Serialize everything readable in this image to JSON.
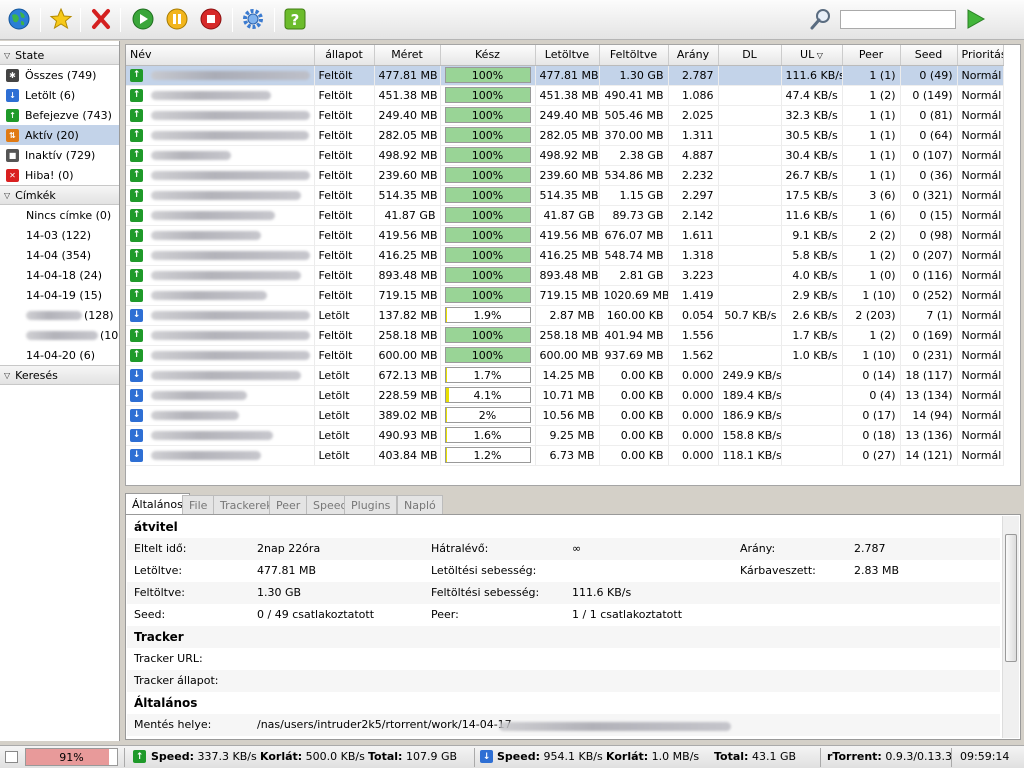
{
  "search": {
    "placeholder": ""
  },
  "sidebar": {
    "state_header": "State",
    "states": [
      {
        "label": "Összes (749)",
        "icon": "all-icon",
        "color": "#444"
      },
      {
        "label": "Letölt (6)",
        "icon": "download-icon",
        "color": "#2e6fd4"
      },
      {
        "label": "Befejezve (743)",
        "icon": "finished-icon",
        "color": "#1f9a2a"
      },
      {
        "label": "Aktív (20)",
        "icon": "active-icon",
        "color": "#e07a14"
      },
      {
        "label": "Inaktív (729)",
        "icon": "inactive-icon",
        "color": "#555"
      },
      {
        "label": "Hiba! (0)",
        "icon": "error-icon",
        "color": "#d92020"
      }
    ],
    "labels_header": "Címkék",
    "labels": [
      {
        "label": "Nincs címke (0)",
        "blur": false
      },
      {
        "label": "14-03 (122)",
        "blur": false
      },
      {
        "label": "14-04 (354)",
        "blur": false
      },
      {
        "label": "14-04-18 (24)",
        "blur": false
      },
      {
        "label": "14-04-19 (15)",
        "blur": false
      },
      {
        "label": "(128)",
        "blur": true
      },
      {
        "label": "(10",
        "blur": true
      },
      {
        "label": "14-04-20 (6)",
        "blur": false
      }
    ],
    "search_header": "Keresés"
  },
  "list": {
    "columns": [
      "Név",
      "állapot",
      "Méret",
      "Kész",
      "Letöltve",
      "Feltöltve",
      "Arány",
      "DL",
      "UL",
      "Peer",
      "Seed",
      "Prioritás"
    ],
    "rows": [
      {
        "status": "Feltölt",
        "dir": "up",
        "size": "477.81 MB",
        "done": "100%",
        "pct": 100,
        "dl": "477.81 MB",
        "ul": "1.30 GB",
        "ratio": "2.787",
        "dlspeed": "",
        "ulspeed": "111.6 KB/s",
        "peer": "1 (1)",
        "seed": "0 (49)",
        "prio": "Normál"
      },
      {
        "status": "Feltölt",
        "dir": "up",
        "size": "451.38 MB",
        "done": "100%",
        "pct": 100,
        "dl": "451.38 MB",
        "ul": "490.41 MB",
        "ratio": "1.086",
        "dlspeed": "",
        "ulspeed": "47.4 KB/s",
        "peer": "1 (2)",
        "seed": "0 (149)",
        "prio": "Normál"
      },
      {
        "status": "Feltölt",
        "dir": "up",
        "size": "249.40 MB",
        "done": "100%",
        "pct": 100,
        "dl": "249.40 MB",
        "ul": "505.46 MB",
        "ratio": "2.025",
        "dlspeed": "",
        "ulspeed": "32.3 KB/s",
        "peer": "1 (1)",
        "seed": "0 (81)",
        "prio": "Normál"
      },
      {
        "status": "Feltölt",
        "dir": "up",
        "size": "282.05 MB",
        "done": "100%",
        "pct": 100,
        "dl": "282.05 MB",
        "ul": "370.00 MB",
        "ratio": "1.311",
        "dlspeed": "",
        "ulspeed": "30.5 KB/s",
        "peer": "1 (1)",
        "seed": "0 (64)",
        "prio": "Normál"
      },
      {
        "status": "Feltölt",
        "dir": "up",
        "size": "498.92 MB",
        "done": "100%",
        "pct": 100,
        "dl": "498.92 MB",
        "ul": "2.38 GB",
        "ratio": "4.887",
        "dlspeed": "",
        "ulspeed": "30.4 KB/s",
        "peer": "1 (1)",
        "seed": "0 (107)",
        "prio": "Normál"
      },
      {
        "status": "Feltölt",
        "dir": "up",
        "size": "239.60 MB",
        "done": "100%",
        "pct": 100,
        "dl": "239.60 MB",
        "ul": "534.86 MB",
        "ratio": "2.232",
        "dlspeed": "",
        "ulspeed": "26.7 KB/s",
        "peer": "1 (1)",
        "seed": "0 (36)",
        "prio": "Normál"
      },
      {
        "status": "Feltölt",
        "dir": "up",
        "size": "514.35 MB",
        "done": "100%",
        "pct": 100,
        "dl": "514.35 MB",
        "ul": "1.15 GB",
        "ratio": "2.297",
        "dlspeed": "",
        "ulspeed": "17.5 KB/s",
        "peer": "3 (6)",
        "seed": "0 (321)",
        "prio": "Normál"
      },
      {
        "status": "Feltölt",
        "dir": "up",
        "size": "41.87 GB",
        "done": "100%",
        "pct": 100,
        "dl": "41.87 GB",
        "ul": "89.73 GB",
        "ratio": "2.142",
        "dlspeed": "",
        "ulspeed": "11.6 KB/s",
        "peer": "1 (6)",
        "seed": "0 (15)",
        "prio": "Normál"
      },
      {
        "status": "Feltölt",
        "dir": "up",
        "size": "419.56 MB",
        "done": "100%",
        "pct": 100,
        "dl": "419.56 MB",
        "ul": "676.07 MB",
        "ratio": "1.611",
        "dlspeed": "",
        "ulspeed": "9.1 KB/s",
        "peer": "2 (2)",
        "seed": "0 (98)",
        "prio": "Normál"
      },
      {
        "status": "Feltölt",
        "dir": "up",
        "size": "416.25 MB",
        "done": "100%",
        "pct": 100,
        "dl": "416.25 MB",
        "ul": "548.74 MB",
        "ratio": "1.318",
        "dlspeed": "",
        "ulspeed": "5.8 KB/s",
        "peer": "1 (2)",
        "seed": "0 (207)",
        "prio": "Normál"
      },
      {
        "status": "Feltölt",
        "dir": "up",
        "size": "893.48 MB",
        "done": "100%",
        "pct": 100,
        "dl": "893.48 MB",
        "ul": "2.81 GB",
        "ratio": "3.223",
        "dlspeed": "",
        "ulspeed": "4.0 KB/s",
        "peer": "1 (0)",
        "seed": "0 (116)",
        "prio": "Normál"
      },
      {
        "status": "Feltölt",
        "dir": "up",
        "size": "719.15 MB",
        "done": "100%",
        "pct": 100,
        "dl": "719.15 MB",
        "ul": "1020.69 MB",
        "ratio": "1.419",
        "dlspeed": "",
        "ulspeed": "2.9 KB/s",
        "peer": "1 (10)",
        "seed": "0 (252)",
        "prio": "Normál"
      },
      {
        "status": "Letölt",
        "dir": "down",
        "size": "137.82 MB",
        "done": "1.9%",
        "pct": 1.9,
        "dl": "2.87 MB",
        "ul": "160.00 KB",
        "ratio": "0.054",
        "dlspeed": "50.7 KB/s",
        "ulspeed": "2.6 KB/s",
        "peer": "2 (203)",
        "seed": "7 (1)",
        "prio": "Normál"
      },
      {
        "status": "Feltölt",
        "dir": "up",
        "size": "258.18 MB",
        "done": "100%",
        "pct": 100,
        "dl": "258.18 MB",
        "ul": "401.94 MB",
        "ratio": "1.556",
        "dlspeed": "",
        "ulspeed": "1.7 KB/s",
        "peer": "1 (2)",
        "seed": "0 (169)",
        "prio": "Normál"
      },
      {
        "status": "Feltölt",
        "dir": "up",
        "size": "600.00 MB",
        "done": "100%",
        "pct": 100,
        "dl": "600.00 MB",
        "ul": "937.69 MB",
        "ratio": "1.562",
        "dlspeed": "",
        "ulspeed": "1.0 KB/s",
        "peer": "1 (10)",
        "seed": "0 (231)",
        "prio": "Normál"
      },
      {
        "status": "Letölt",
        "dir": "down",
        "size": "672.13 MB",
        "done": "1.7%",
        "pct": 1.7,
        "dl": "14.25 MB",
        "ul": "0.00 KB",
        "ratio": "0.000",
        "dlspeed": "249.9 KB/s",
        "ulspeed": "",
        "peer": "0 (14)",
        "seed": "18 (117)",
        "prio": "Normál"
      },
      {
        "status": "Letölt",
        "dir": "down",
        "size": "228.59 MB",
        "done": "4.1%",
        "pct": 4.1,
        "dl": "10.71 MB",
        "ul": "0.00 KB",
        "ratio": "0.000",
        "dlspeed": "189.4 KB/s",
        "ulspeed": "",
        "peer": "0 (4)",
        "seed": "13 (134)",
        "prio": "Normál"
      },
      {
        "status": "Letölt",
        "dir": "down",
        "size": "389.02 MB",
        "done": "2%",
        "pct": 2,
        "dl": "10.56 MB",
        "ul": "0.00 KB",
        "ratio": "0.000",
        "dlspeed": "186.9 KB/s",
        "ulspeed": "",
        "peer": "0 (17)",
        "seed": "14 (94)",
        "prio": "Normál"
      },
      {
        "status": "Letölt",
        "dir": "down",
        "size": "490.93 MB",
        "done": "1.6%",
        "pct": 1.6,
        "dl": "9.25 MB",
        "ul": "0.00 KB",
        "ratio": "0.000",
        "dlspeed": "158.8 KB/s",
        "ulspeed": "",
        "peer": "0 (18)",
        "seed": "13 (136)",
        "prio": "Normál"
      },
      {
        "status": "Letölt",
        "dir": "down",
        "size": "403.84 MB",
        "done": "1.2%",
        "pct": 1.2,
        "dl": "6.73 MB",
        "ul": "0.00 KB",
        "ratio": "0.000",
        "dlspeed": "118.1 KB/s",
        "ulspeed": "",
        "peer": "0 (27)",
        "seed": "14 (121)",
        "prio": "Normál"
      }
    ]
  },
  "tabs": [
    "Általános",
    "File",
    "Trackerek",
    "Peer",
    "Speed",
    "Plugins",
    "Napló"
  ],
  "details": {
    "section_transfer": "átvitel",
    "elapsed_label": "Eltelt idő:",
    "elapsed": "2nap 22óra",
    "remaining_label": "Hátralévő:",
    "remaining": "∞",
    "ratio_label": "Arány:",
    "ratio": "2.787",
    "downloaded_label": "Letöltve:",
    "downloaded": "477.81 MB",
    "dlspeed_label": "Letöltési sebesség:",
    "dlspeed": "",
    "wasted_label": "Kárbaveszett:",
    "wasted": "2.83 MB",
    "uploaded_label": "Feltöltve:",
    "uploaded": "1.30 GB",
    "ulspeed_label": "Feltöltési sebesség:",
    "ulspeed": "111.6 KB/s",
    "seed_label": "Seed:",
    "seed": "0 / 49 csatlakoztatott",
    "peer_label": "Peer:",
    "peer": "1 / 1 csatlakoztatott",
    "section_tracker": "Tracker",
    "tracker_url_label": "Tracker URL:",
    "tracker_url": "",
    "tracker_status_label": "Tracker állapot:",
    "tracker_status": "",
    "section_general": "Általános",
    "save_path_label": "Mentés helye:",
    "save_path": "/nas/users/intruder2k5/rtorrent/work/14-04-17"
  },
  "statusbar": {
    "disk": "91%",
    "disk_pct": 91,
    "up_speed_label": "Speed:",
    "up_speed": "337.3 KB/s",
    "up_limit_label": "Korlát:",
    "up_limit": "500.0 KB/s",
    "up_total_label": "Total:",
    "up_total": "107.9 GB",
    "down_speed_label": "Speed:",
    "down_speed": "954.1 KB/s",
    "down_limit_label": "Korlát:",
    "down_limit": "1.0 MB/s",
    "down_total_label": "Total:",
    "down_total": "43.1 GB",
    "client_label": "rTorrent:",
    "client_version": "0.9.3/0.13.3",
    "time": "09:59:14"
  },
  "colors": {
    "selected": "#c3d3e9",
    "progress_done": "#99d496",
    "progress_partial": "#e8e000",
    "disk_bar": "#e89a9a"
  }
}
